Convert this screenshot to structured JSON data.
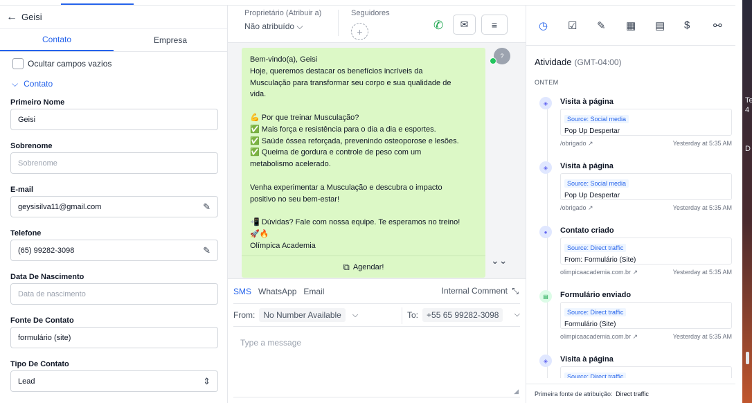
{
  "left": {
    "contact_name": "Geisi",
    "tabs": [
      "Contato",
      "Empresa"
    ],
    "hide_empty_label": "Ocultar campos vazios",
    "section_label": "Contato",
    "fields": [
      {
        "label": "Primeiro Nome",
        "value": "Geisi",
        "placeholder": ""
      },
      {
        "label": "Sobrenome",
        "value": "",
        "placeholder": "Sobrenome"
      },
      {
        "label": "E-mail",
        "value": "geysisilva11@gmail.com",
        "placeholder": ""
      },
      {
        "label": "Telefone",
        "value": "(65) 99282-3098",
        "placeholder": ""
      },
      {
        "label": "Data De Nascimento",
        "value": "",
        "placeholder": "Data de nascimento"
      },
      {
        "label": "Fonte De Contato",
        "value": "formulário (site)",
        "placeholder": ""
      },
      {
        "label": "Tipo De Contato",
        "value": "Lead",
        "placeholder": ""
      }
    ]
  },
  "middle": {
    "owner_label": "Proprietário (Atribuir a)",
    "owner_value": "Não atribuído",
    "followers_label": "Seguidores",
    "message_lines": "Bem-vindo(a), Geisi\nHoje, queremos destacar os benefícios incríveis da\nMusculação para transformar seu corpo e sua qualidade de\nvida.\n\n💪 Por que treinar Musculação?\n✅ Mais força e resistência para o dia a dia e esportes.\n✅ Saúde óssea reforçada, prevenindo osteoporose e lesões.\n✅ Queima de gordura e controle de peso com um\nmetabolismo acelerado.\n\nVenha experimentar a Musculação e descubra o impacto\npositivo no seu bem-estar!\n\n📲 Dúvidas? Fale com nossa equipe. Te esperamos no treino!\n🚀🔥\nOlímpica Academia",
    "agendar_label": "Agendar!",
    "compose_tabs": [
      "SMS",
      "WhatsApp",
      "Email"
    ],
    "internal_comment": "Internal Comment",
    "from_label": "From:",
    "from_value": "No Number Available",
    "to_label": "To:",
    "to_value": "+55 65 99282-3098",
    "message_placeholder": "Type a message"
  },
  "right": {
    "activity_title": "Atividade",
    "timezone": "(GMT-04:00)",
    "group_label": "ONTEM",
    "events": [
      {
        "title": "Visita à página",
        "source": "Source: Social media",
        "content": "Pop Up Despertar",
        "link": "/obrigado ↗",
        "time": "Yesterday at 5:35 AM"
      },
      {
        "title": "Visita à página",
        "source": "Source: Social media",
        "content": "Pop Up Despertar",
        "link": "/obrigado ↗",
        "time": "Yesterday at 5:35 AM"
      },
      {
        "title": "Contato criado",
        "source": "Source: Direct traffic",
        "content": "From: Formulário (Site)",
        "link": "olimpicaacademia.com.br ↗",
        "time": "Yesterday at 5:35 AM"
      },
      {
        "title": "Formulário enviado",
        "source": "Source: Direct traffic",
        "content": "Formulário (Site)",
        "link": "olimpicaacademia.com.br ↗",
        "time": "Yesterday at 5:35 AM"
      },
      {
        "title": "Visita à página",
        "source": "Source: Direct traffic",
        "content": "",
        "link": "",
        "time": ""
      }
    ],
    "footer_label": "Primeira fonte de atribuição:",
    "footer_value": "Direct traffic"
  },
  "edge_letters": "Te\n4\n\n\n\nD",
  "colors": {
    "accent": "#2563eb",
    "bubble": "#dcf8c6",
    "green": "#16a34a"
  }
}
